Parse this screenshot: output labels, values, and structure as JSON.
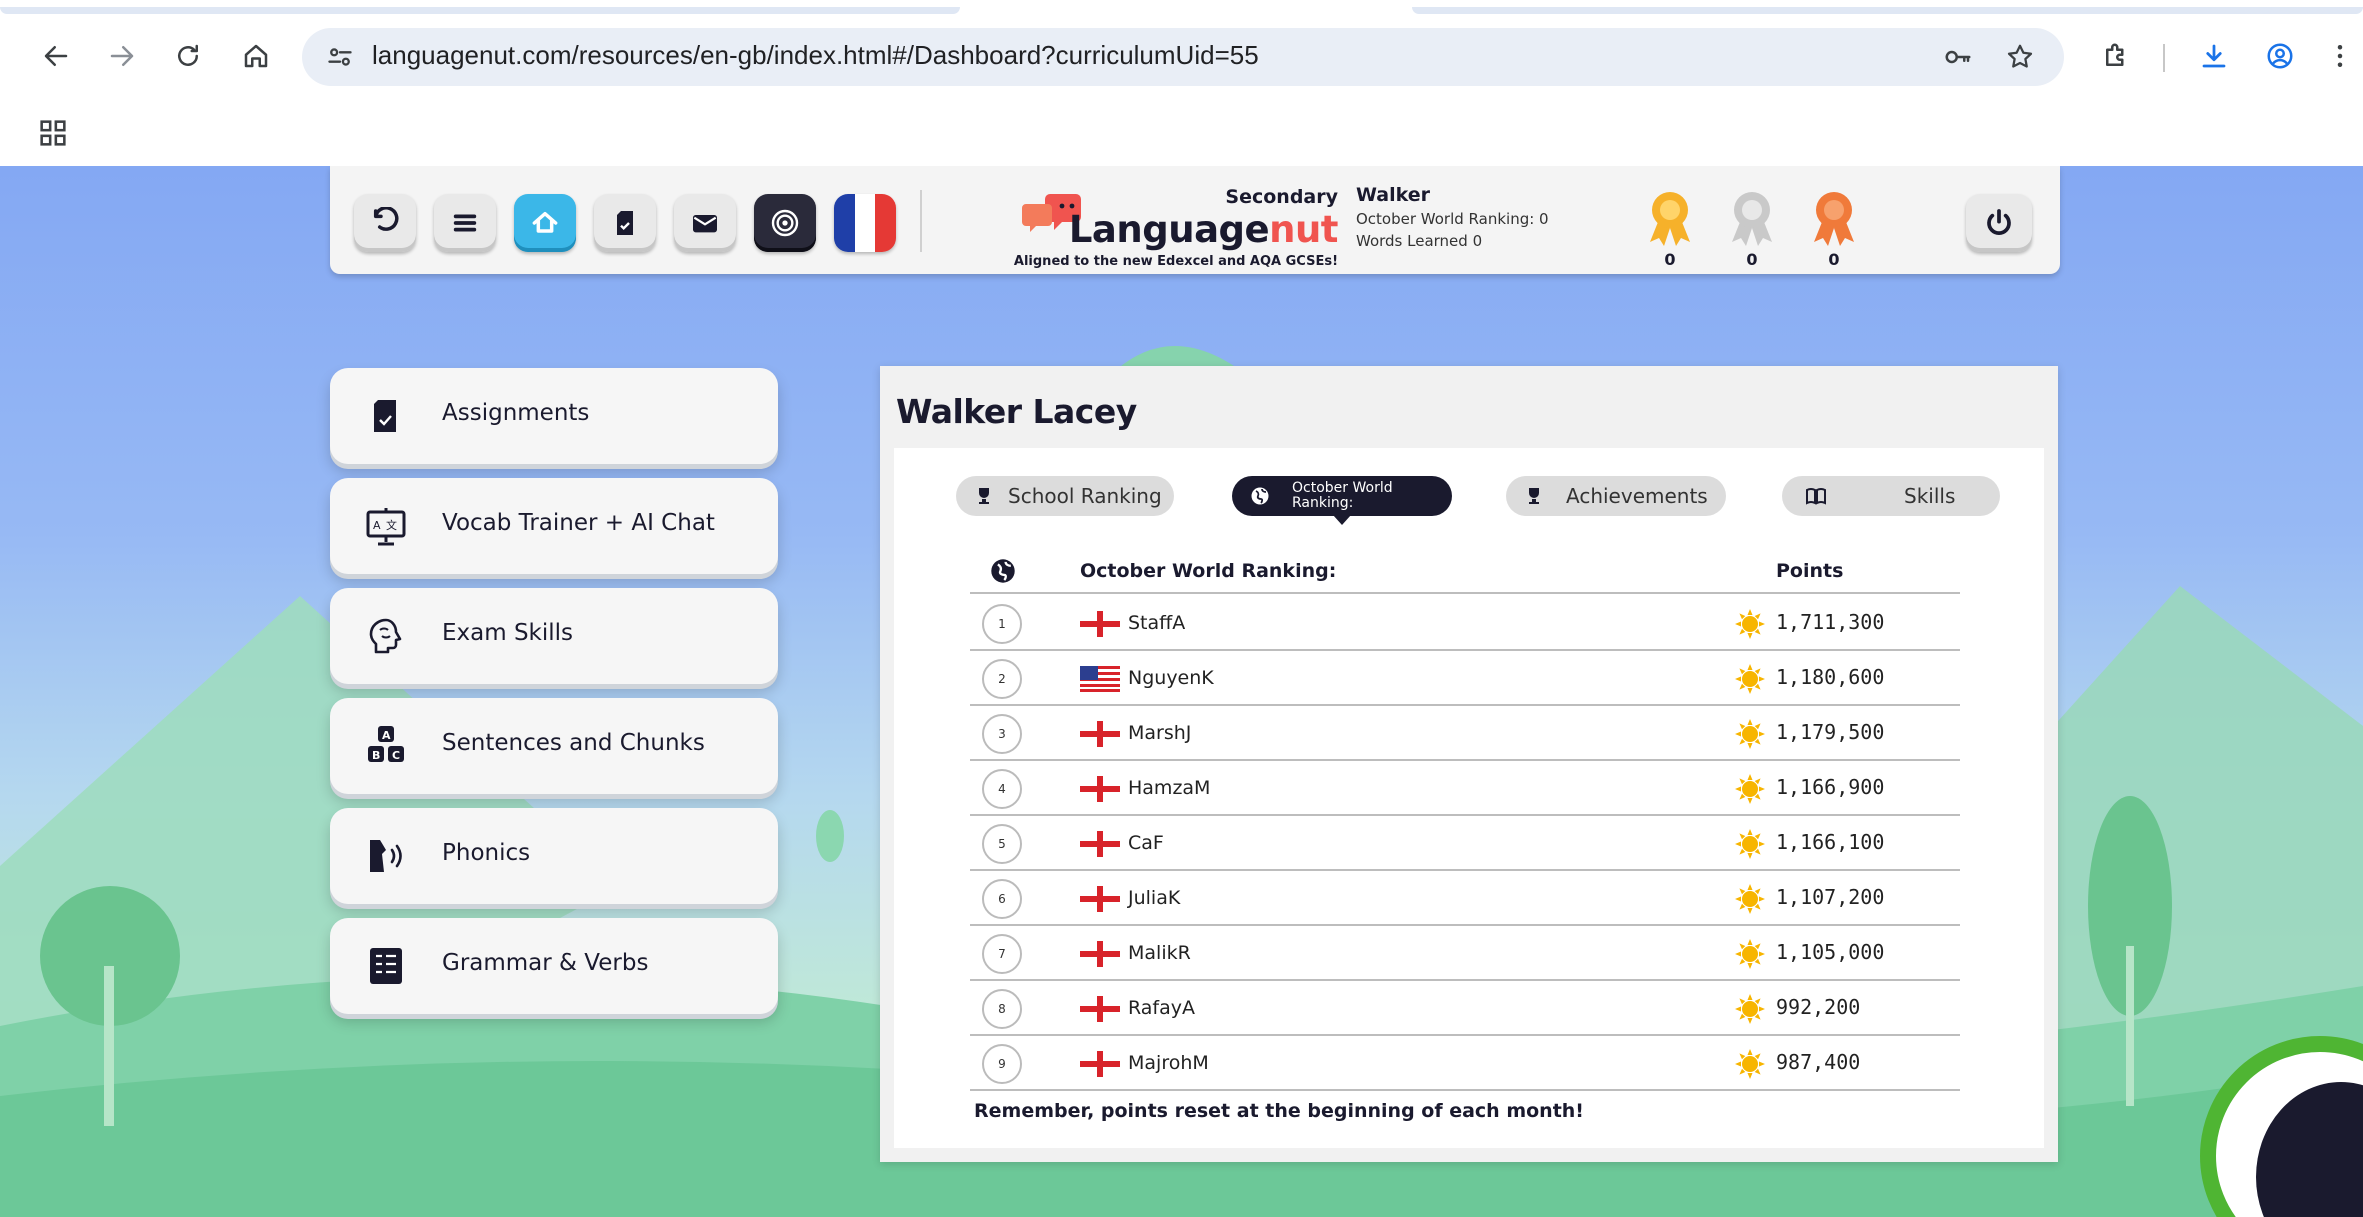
{
  "browser": {
    "url": "languagenut.com/resources/en-gb/index.html#/Dashboard?curriculumUid=55"
  },
  "header": {
    "logo": {
      "secondary": "Secondary",
      "word_main": "Language",
      "word_accent": "nut",
      "tagline": "Aligned to the new Edexcel and AQA GCSEs!"
    },
    "user": {
      "name": "Walker",
      "ranking_line": "October World Ranking: 0",
      "words_line": "Words Learned 0"
    },
    "medals": [
      {
        "name": "gold-medal-icon",
        "count": "0",
        "color": "#f6b12a"
      },
      {
        "name": "silver-medal-icon",
        "count": "0",
        "color": "#c9c9c9"
      },
      {
        "name": "bronze-medal-icon",
        "count": "0",
        "color": "#f07a3a"
      }
    ]
  },
  "menu": {
    "items": [
      {
        "label": "Assignments",
        "icon": "assignment-icon"
      },
      {
        "label": "Vocab Trainer + AI Chat",
        "icon": "vocab-trainer-icon"
      },
      {
        "label": "Exam Skills",
        "icon": "brain-icon"
      },
      {
        "label": "Sentences and Chunks",
        "icon": "abc-blocks-icon"
      },
      {
        "label": "Phonics",
        "icon": "phonics-icon"
      },
      {
        "label": "Grammar & Verbs",
        "icon": "grammar-icon"
      }
    ]
  },
  "panel": {
    "title": "Walker Lacey",
    "tabs": {
      "school": "School Ranking",
      "world": "October World Ranking:",
      "achievements": "Achievements",
      "skills": "Skills"
    },
    "table": {
      "header_title": "October World Ranking:",
      "header_points": "Points",
      "rows": [
        {
          "rank": "1",
          "name": "StaffA",
          "flag": "england",
          "points": "1,711,300"
        },
        {
          "rank": "2",
          "name": "NguyenK",
          "flag": "usa",
          "points": "1,180,600"
        },
        {
          "rank": "3",
          "name": "MarshJ",
          "flag": "england",
          "points": "1,179,500"
        },
        {
          "rank": "4",
          "name": "HamzaM",
          "flag": "england",
          "points": "1,166,900"
        },
        {
          "rank": "5",
          "name": "CaF",
          "flag": "england",
          "points": "1,166,100"
        },
        {
          "rank": "6",
          "name": "JuliaK",
          "flag": "england",
          "points": "1,107,200"
        },
        {
          "rank": "7",
          "name": "MalikR",
          "flag": "england",
          "points": "1,105,000"
        },
        {
          "rank": "8",
          "name": "RafayA",
          "flag": "england",
          "points": "992,200"
        },
        {
          "rank": "9",
          "name": "MajrohM",
          "flag": "england",
          "points": "987,400"
        }
      ]
    },
    "reminder": "Remember, points reset at the beginning of each month!"
  },
  "colors": {
    "accent_dark": "#1a1a2e",
    "logo_accent": "#f0544f",
    "home_button": "#3bb7e8",
    "chat_ring": "#4fb533"
  }
}
